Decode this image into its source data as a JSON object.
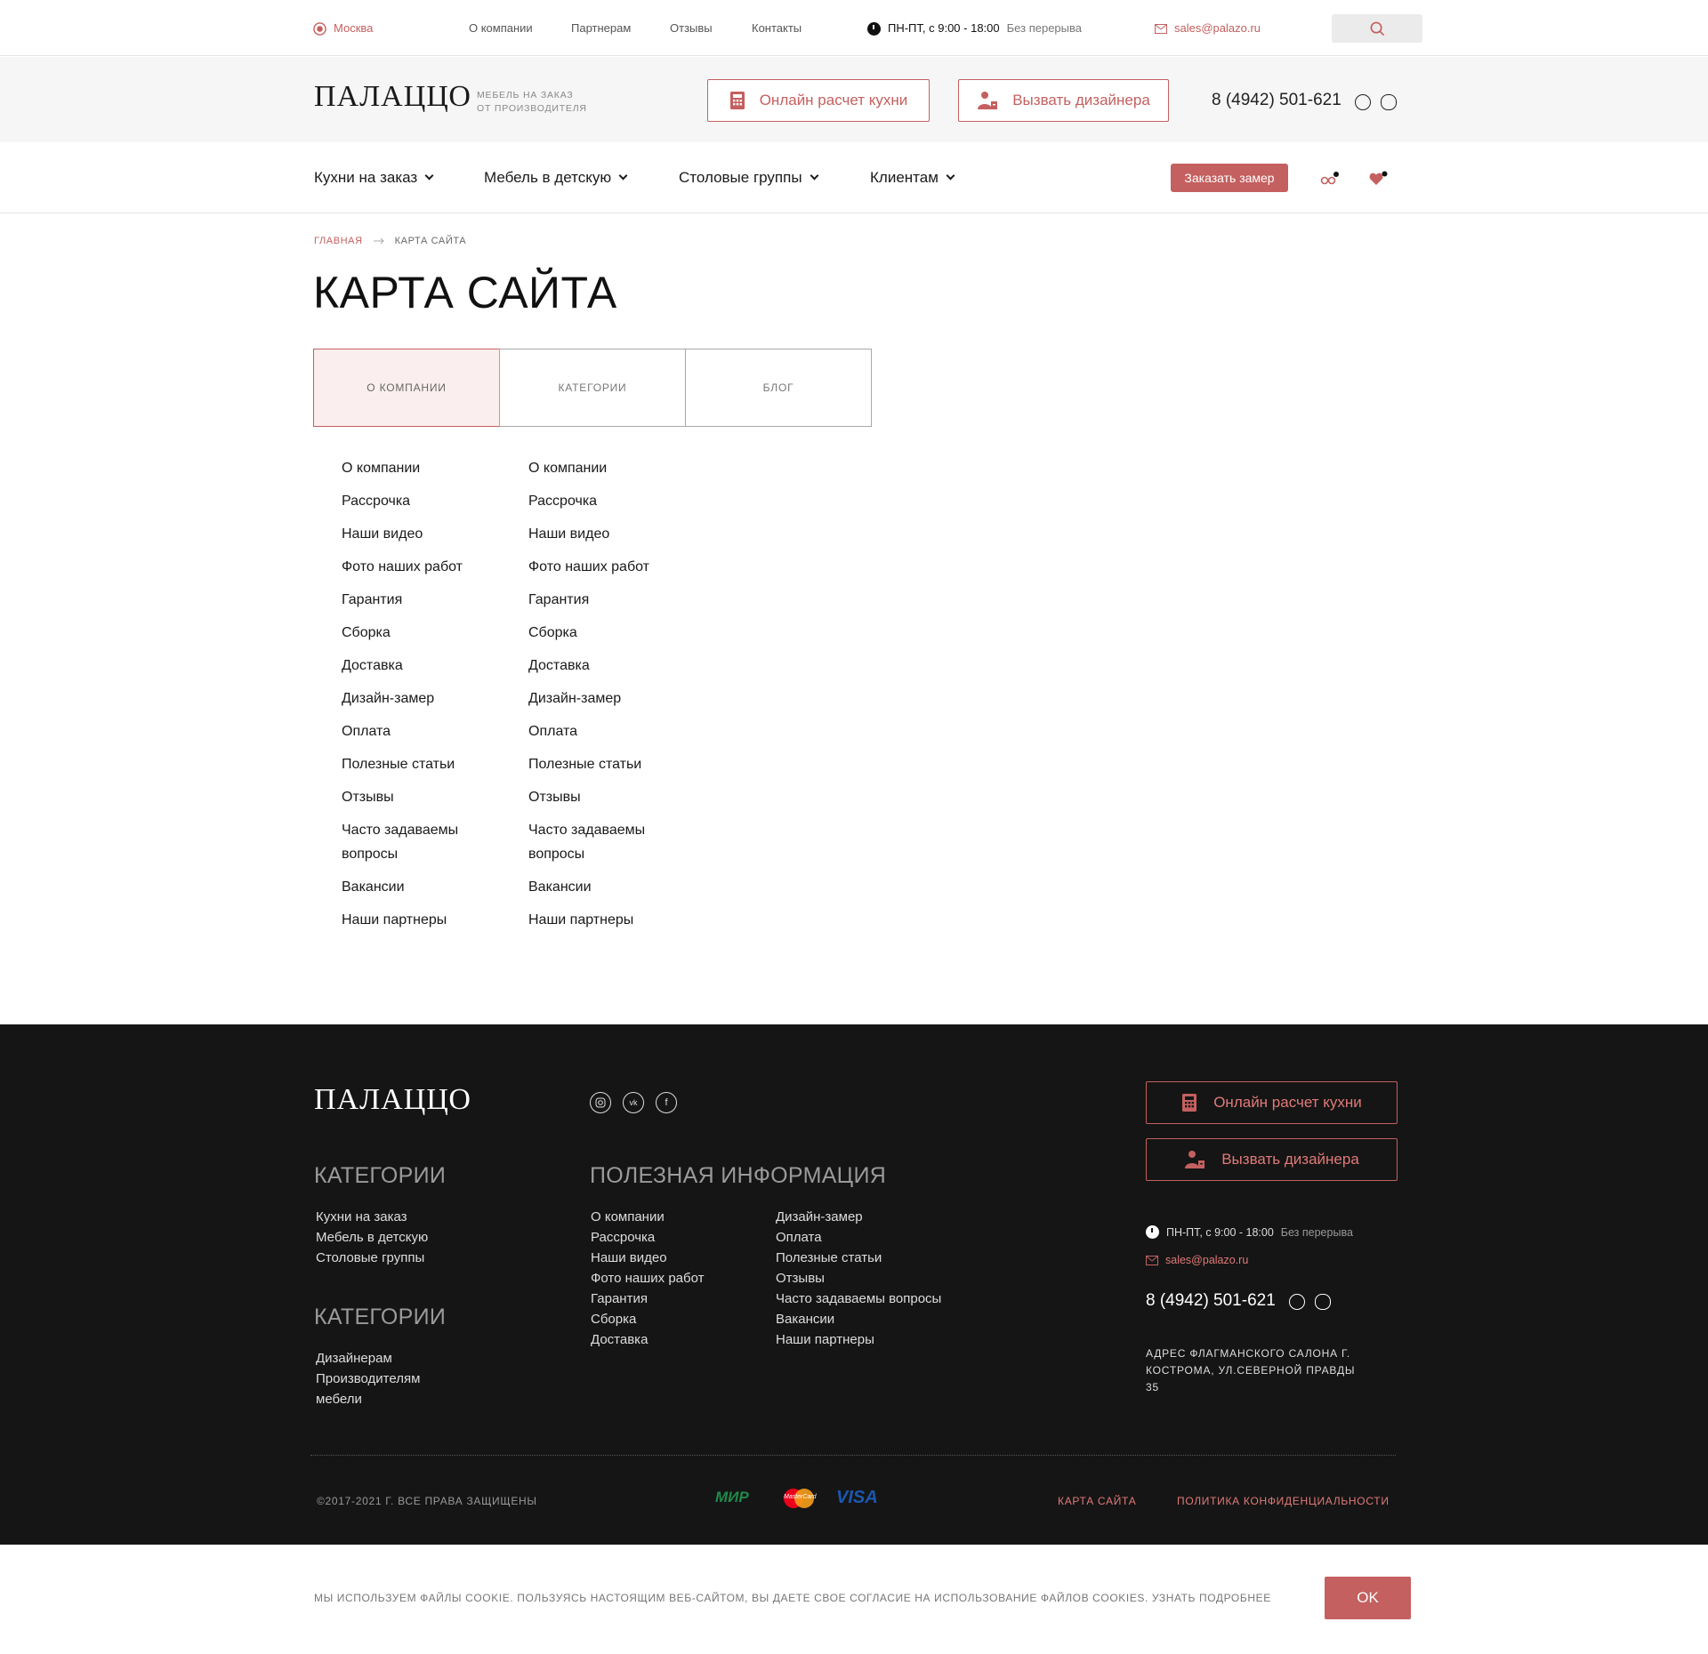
{
  "topbar": {
    "city": "Москва",
    "links": [
      "О компании",
      "Партнерам",
      "Отзывы",
      "Контакты"
    ],
    "hours": "ПН-ПТ, с 9:00 - 18:00",
    "no_break": "Без перерыва",
    "email": "sales@palazo.ru"
  },
  "header": {
    "logo": "ПАЛАЦЦО",
    "tagline_line1": "МЕБЕЛЬ НА ЗАКАЗ",
    "tagline_line2": "ОТ ПРОИЗВОДИТЕЛЯ",
    "calc_button": "Онлайн расчет кухни",
    "designer_button": "Вызвать дизайнера",
    "phone": "8 (4942) 501-621"
  },
  "nav": {
    "items": [
      "Кухни на заказ",
      "Мебель в детскую",
      "Столовые группы",
      "Клиентам"
    ],
    "order_button": "Заказать замер"
  },
  "breadcrumb": {
    "home": "ГЛАВНАЯ",
    "current": "КАРТА САЙТА"
  },
  "page_title": "КАРТА САЙТА",
  "tabs": [
    "О КОМПАНИИ",
    "КАТЕГОРИИ",
    "БЛОГ"
  ],
  "sitemap_col1": [
    "О компании",
    "Рассрочка",
    "Наши видео",
    "Фото наших работ",
    "Гарантия",
    "Сборка",
    "Доставка",
    "Дизайн-замер",
    "Оплата",
    "Полезные статьи",
    "Отзывы",
    "Часто задаваемы вопросы",
    "Вакансии",
    "Наши партнеры"
  ],
  "sitemap_col2": [
    "О компании",
    "Рассрочка",
    "Наши видео",
    "Фото наших работ",
    "Гарантия",
    "Сборка",
    "Доставка",
    "Дизайн-замер",
    "Оплата",
    "Полезные статьи",
    "Отзывы",
    "Часто задаваемы вопросы",
    "Вакансии",
    "Наши партнеры"
  ],
  "footer": {
    "logo": "ПАЛАЦЦО",
    "categories_title": "КАТЕГОРИИ",
    "categories": [
      "Кухни на заказ",
      "Мебель в детскую",
      "Столовые группы"
    ],
    "categories2_title": "КАТЕГОРИИ",
    "categories2": [
      "Дизайнерам",
      "Производителям мебели"
    ],
    "info_title": "ПОЛЕЗНАЯ ИНФОРМАЦИЯ",
    "info_col1": [
      "О компании",
      "Рассрочка",
      "Наши видео",
      "Фото наших работ",
      "Гарантия",
      "Сборка",
      "Доставка"
    ],
    "info_col2": [
      "Дизайн-замер",
      "Оплата",
      "Полезные статьи",
      "Отзывы",
      "Часто задаваемы вопросы",
      "Вакансии",
      "Наши партнеры"
    ],
    "calc_button": "Онлайн расчет кухни",
    "designer_button": "Вызвать дизайнера",
    "hours": "ПН-ПТ, с 9:00 - 18:00",
    "no_break": "Без перерыва",
    "email": "sales@palazo.ru",
    "phone": "8 (4942) 501-621",
    "address": "АДРЕС ФЛАГМАНСКОГО САЛОНА Г. КОСТРОМА, УЛ.СЕВЕРНОЙ ПРАВДЫ 35",
    "copyright": "©2017-2021 Г. ВСЕ ПРАВА ЗАЩИЩЕНЫ",
    "payment_mir": "МИР",
    "payment_mastercard": "MasterCard",
    "payment_visa": "VISA",
    "sitemap_link": "КАРТА САЙТА",
    "privacy_link": "ПОЛИТИКА КОНФИДЕНЦИАЛЬНОСТИ"
  },
  "cookie": {
    "text": "МЫ ИСПОЛЬЗУЕМ ФАЙЛЫ COOKIE. ПОЛЬЗУЯСЬ НАСТОЯЩИМ ВЕБ-САЙТОМ, ВЫ ДАЕТЕ СВОЕ СОГЛАСИЕ НА ИСПОЛЬЗОВАНИЕ ФАЙЛОВ COOKIES. УЗНАТЬ ПОДРОБНЕЕ",
    "ok": "OK"
  },
  "colors": {
    "accent": "#c4605f",
    "footer_bg": "#151515",
    "header_bg": "#f6f6f6",
    "tab_active_bg": "#fbeeee"
  },
  "icons": [
    "location-pin-icon",
    "clock-icon",
    "mail-icon",
    "search-icon",
    "calculator-icon",
    "designer-icon",
    "whatsapp-icon",
    "viber-icon",
    "compare-icon",
    "heart-icon",
    "instagram-icon",
    "vk-icon",
    "facebook-icon",
    "arrow-right-icon",
    "chevron-down-icon"
  ]
}
